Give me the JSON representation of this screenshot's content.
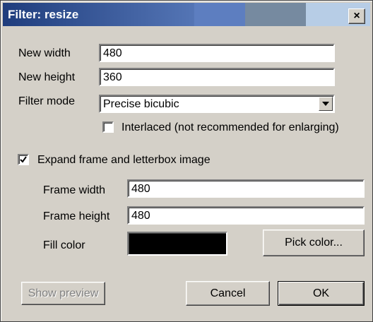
{
  "window": {
    "title": "Filter: resize",
    "close_glyph": "×",
    "close_icon": "close-icon",
    "title_gradient": [
      "#1f3d7d",
      "#5475b5",
      "#5d7ec0",
      "#768aa0",
      "#b7cde6"
    ]
  },
  "fields": {
    "new_width": {
      "label": "New width",
      "value": "480"
    },
    "new_height": {
      "label": "New height",
      "value": "360"
    },
    "filter_mode": {
      "label": "Filter mode",
      "value": "Precise bicubic"
    }
  },
  "interlaced": {
    "label": "Interlaced (not recommended for enlarging)",
    "checked": false
  },
  "expand": {
    "label": "Expand frame and letterbox image",
    "checked": true
  },
  "frame": {
    "width": {
      "label": "Frame width",
      "value": "480"
    },
    "height": {
      "label": "Frame height",
      "value": "480"
    },
    "fill": {
      "label": "Fill color",
      "color": "#000000"
    }
  },
  "buttons": {
    "pick_color": "Pick color...",
    "show_preview": "Show preview",
    "cancel": "Cancel",
    "ok": "OK"
  }
}
